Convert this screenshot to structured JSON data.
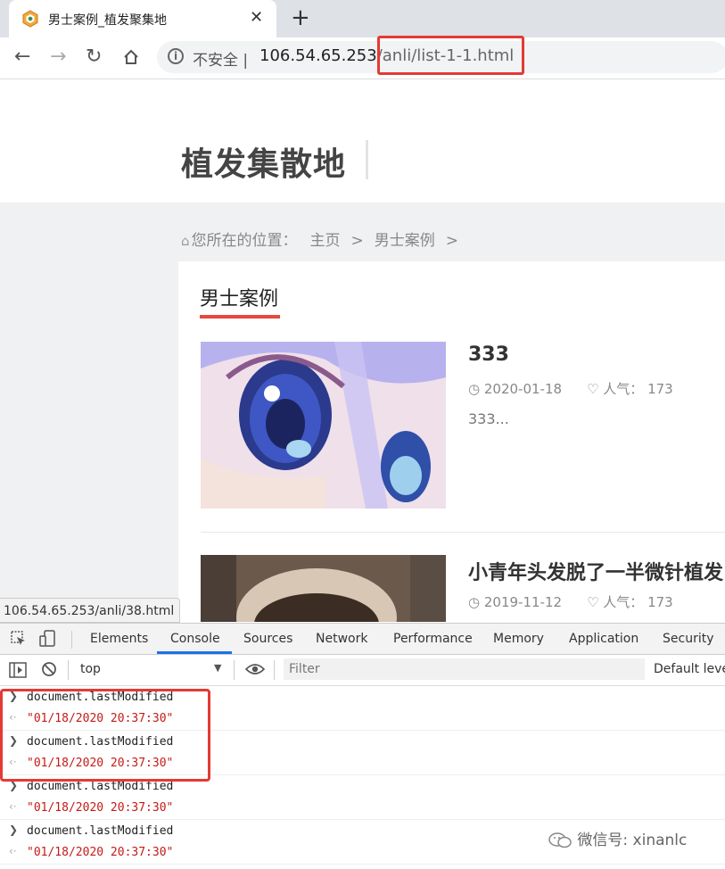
{
  "browser": {
    "tab_title": "男士案例_植发聚集地",
    "new_tab_symbol": "+",
    "close_symbol": "✕",
    "security_label": "不安全",
    "url_host": "106.54.65.253",
    "url_path": "/anli/list-1-1.html",
    "status_link": "106.54.65.253/anli/38.html"
  },
  "page": {
    "site_name": "植发集散地",
    "breadcrumb": {
      "prefix": "您所在的位置：",
      "items": [
        "主页",
        "男士案例"
      ],
      "separator": ">"
    },
    "section_title": "男士案例",
    "articles": [
      {
        "title": "333",
        "date": "2020-01-18",
        "popularity_label": "人气：",
        "popularity": "173",
        "excerpt": "333..."
      },
      {
        "title": "小青年头发脱了一半微针植发",
        "date": "2019-11-12",
        "popularity_label": "人气：",
        "popularity": "173"
      }
    ],
    "accent_color": "#e6483d"
  },
  "devtools": {
    "tabs": [
      "Elements",
      "Console",
      "Sources",
      "Network",
      "Performance",
      "Memory",
      "Application",
      "Security"
    ],
    "active_tab": "Console",
    "context": "top",
    "filter_placeholder": "Filter",
    "levels": "Default leve",
    "entries": [
      {
        "input": "document.lastModified",
        "output": "\"01/18/2020 20:37:30\""
      },
      {
        "input": "document.lastModified",
        "output": "\"01/18/2020 20:37:30\""
      },
      {
        "input": "document.lastModified",
        "output": "\"01/18/2020 20:37:30\""
      },
      {
        "input": "document.lastModified",
        "output": "\"01/18/2020 20:37:30\""
      }
    ]
  },
  "watermark": "微信号: xinanlc"
}
